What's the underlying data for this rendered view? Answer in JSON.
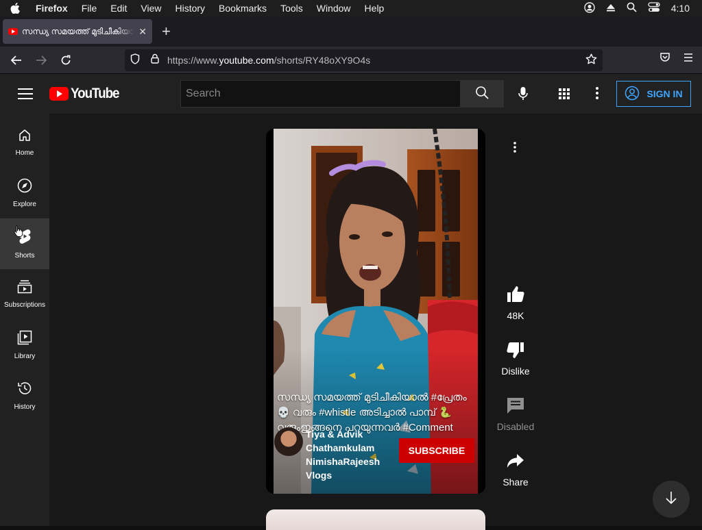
{
  "menubar": {
    "app": "Firefox",
    "items": [
      "File",
      "Edit",
      "View",
      "History",
      "Bookmarks",
      "Tools",
      "Window",
      "Help"
    ],
    "clock": "4:10"
  },
  "browser": {
    "tab_title": "സന്ധ്യ സമയത്ത് മുടിചീകിയാൽ #പ്രേതം",
    "url_prefix": "https://www.",
    "url_domain": "youtube.com",
    "url_path": "/shorts/RY48oXY9O4s"
  },
  "youtube": {
    "logo_text": "YouTube",
    "search_placeholder": "Search",
    "sign_in_label": "SIGN IN",
    "sidebar": [
      {
        "label": "Home",
        "icon": "home-icon"
      },
      {
        "label": "Explore",
        "icon": "compass-icon"
      },
      {
        "label": "Shorts",
        "icon": "shorts-icon"
      },
      {
        "label": "Subscriptions",
        "icon": "subscriptions-icon"
      },
      {
        "label": "Library",
        "icon": "library-icon"
      },
      {
        "label": "History",
        "icon": "history-icon"
      }
    ],
    "short": {
      "caption_line1": "സന്ധ്യ സമയത്ത് മുടിചീകിയാൽ #പ്രേതം",
      "caption_line2": "💀 വരും #whistle അടിച്ചാൽ പാമ്പ് 🐍",
      "caption_line3": "വരുംഇങ്ങനെ പറയുന്നവർ #Comment",
      "channel_name": "Tiya & Advik Chathamkulam NimishaRajeesh Vlogs",
      "subscribe_label": "SUBSCRIBE"
    },
    "actions": {
      "likes": "48K",
      "dislike": "Dislike",
      "comments": "Disabled",
      "share": "Share"
    }
  },
  "colors": {
    "accent_blue": "#3ea6ff",
    "brand_red": "#ff0000",
    "subscribe_red": "#cc0000"
  }
}
